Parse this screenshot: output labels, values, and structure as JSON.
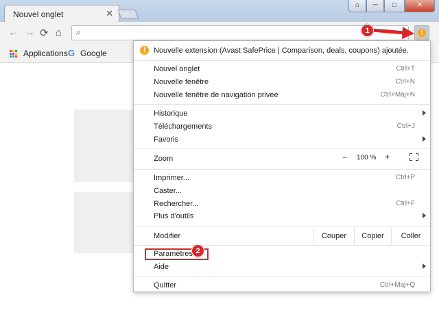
{
  "window": {
    "tab_title": "Nouvel onglet",
    "tab_close": "✕",
    "minimize": "─",
    "restore": "□",
    "close": "✕",
    "user_switch": "⌂"
  },
  "toolbar": {
    "back": "←",
    "forward": "→",
    "reload": "⟳",
    "home": "⌂",
    "search_glyph": "⌕",
    "extension_badge": "!"
  },
  "bookmarks": {
    "apps_label": "Applications",
    "google_label": "Google",
    "google_glyph": "G",
    "apps_colors": [
      "#ea4335",
      "#fbbc05",
      "#34a853",
      "#4285f4",
      "#ea4335",
      "#fbbc05",
      "#34a853",
      "#4285f4",
      "#ea4335"
    ]
  },
  "menu": {
    "notice_icon": "!",
    "notice": "Nouvelle extension (Avast SafePrice | Comparison, deals, coupons) ajoutée.",
    "new_tab": {
      "label": "Nouvel onglet",
      "shortcut": "Ctrl+T"
    },
    "new_window": {
      "label": "Nouvelle fenêtre",
      "shortcut": "Ctrl+N"
    },
    "incognito": {
      "label": "Nouvelle fenêtre de navigation privée",
      "shortcut": "Ctrl+Maj+N"
    },
    "history": {
      "label": "Historique"
    },
    "downloads": {
      "label": "Téléchargements",
      "shortcut": "Ctrl+J"
    },
    "bookmarks": {
      "label": "Favoris"
    },
    "zoom": {
      "label": "Zoom",
      "minus": "−",
      "value": "100 %",
      "plus": "+"
    },
    "print": {
      "label": "Imprimer...",
      "shortcut": "Ctrl+P"
    },
    "cast": {
      "label": "Caster..."
    },
    "find": {
      "label": "Rechercher...",
      "shortcut": "Ctrl+F"
    },
    "more_tools": {
      "label": "Plus d'outils"
    },
    "edit": {
      "label": "Modifier",
      "cut": "Couper",
      "copy": "Copier",
      "paste": "Coller"
    },
    "settings": {
      "label": "Paramètres"
    },
    "help": {
      "label": "Aide"
    },
    "exit": {
      "label": "Quitter",
      "shortcut": "Ctrl+Maj+Q"
    }
  },
  "annotations": {
    "step1": "1",
    "step2": "2",
    "color": "#d9262b"
  }
}
